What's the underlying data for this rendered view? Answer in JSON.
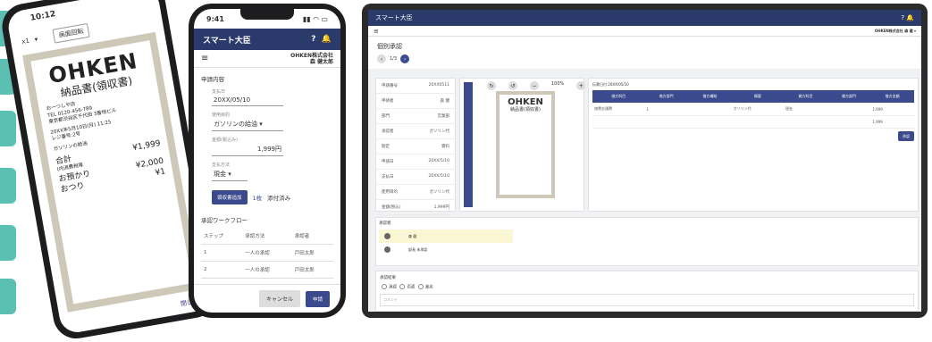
{
  "brand": {
    "accent": "#2a3a6b",
    "tab": "#5bbfb1"
  },
  "phone1": {
    "time": "10:12",
    "qty": "x1",
    "btn": "画面回転",
    "receipt": {
      "logo": "OHKEN",
      "title": "納品書(領収書)",
      "shop": "お一つしや店",
      "phone": "TEL 0120-456-789",
      "addr": "東京都渋谷区千代田 3番地ビル",
      "date": "20XX年5月10日(月) 11:25",
      "reg": "レジ番号:2号",
      "item1": "ガソリンの給油",
      "total_label": "合計",
      "total": "¥1,999",
      "tax": "(内消費税等",
      "azukari_label": "お預かり",
      "azukari": "¥2,000",
      "change_label": "おつり",
      "change": "¥1"
    },
    "close": "閉じる"
  },
  "phone2": {
    "time": "9:41",
    "app": "スマート大臣",
    "badge": "1",
    "company": "OHKEN株式会社",
    "user": "森 健太郎",
    "section": "申請内容",
    "date_label": "支払日",
    "date": "20XX/05/10",
    "purpose_label": "使用目的",
    "purpose": "ガソリンの給油",
    "amount_label": "金額(税込み)",
    "amount": "1,999",
    "unit": "円",
    "pay_label": "支払方法",
    "pay": "現金",
    "attach_btn": "領収書追加",
    "attach_count": "1枚",
    "attach_status": "添付済み",
    "wf_title": "承認ワークフロー",
    "wf_cols": [
      "ステップ",
      "承認方法",
      "承認者"
    ],
    "wf_rows": [
      [
        "1",
        "一人の承認",
        "戸田太郎"
      ],
      [
        "2",
        "一人の承認",
        "戸田太郎"
      ]
    ],
    "cancel": "キャンセル",
    "submit": "申請"
  },
  "desktop": {
    "app": "スマート大臣",
    "company": "OHKEN株式会社",
    "user": "森 健",
    "page_title": "個別承認",
    "pager": "1/3",
    "left_fields": [
      [
        "申請番号",
        "20XX0511"
      ],
      [
        "申請者",
        "森 健"
      ],
      [
        "部門",
        "営業部"
      ],
      [
        "承認者",
        "ガソリン代"
      ],
      [
        "勘定",
        "資料"
      ],
      [
        "申請日",
        "20XX/5/10"
      ],
      [
        "支払日",
        "20XX/5/10"
      ],
      [
        "使用目的",
        "ガソリン代"
      ],
      [
        "金額(税込)",
        "1,999円"
      ],
      [
        "支払方法",
        "現金"
      ]
    ],
    "zoom": "100%",
    "mini_logo": "OHKEN",
    "mini_title": "納品書(領収書)",
    "ledger_date": "伝票日付 20XX/05/10",
    "ledger_cols": [
      "借方科目",
      "借方部門",
      "借方補助",
      "摘要",
      "貸方科目",
      "貸方部門",
      "借方金額"
    ],
    "ledger_row": [
      "旅費交通費",
      "1",
      "ガソリン代",
      "現金",
      "1,999"
    ],
    "ledger_sum": "1,999",
    "approve": "承認",
    "wf_label": "承認者",
    "wf_rows": [
      "森 健",
      "部長 未承認"
    ],
    "result_label": "承認結果",
    "options": [
      "承認",
      "否認",
      "差戻"
    ],
    "comment": "コメント"
  }
}
